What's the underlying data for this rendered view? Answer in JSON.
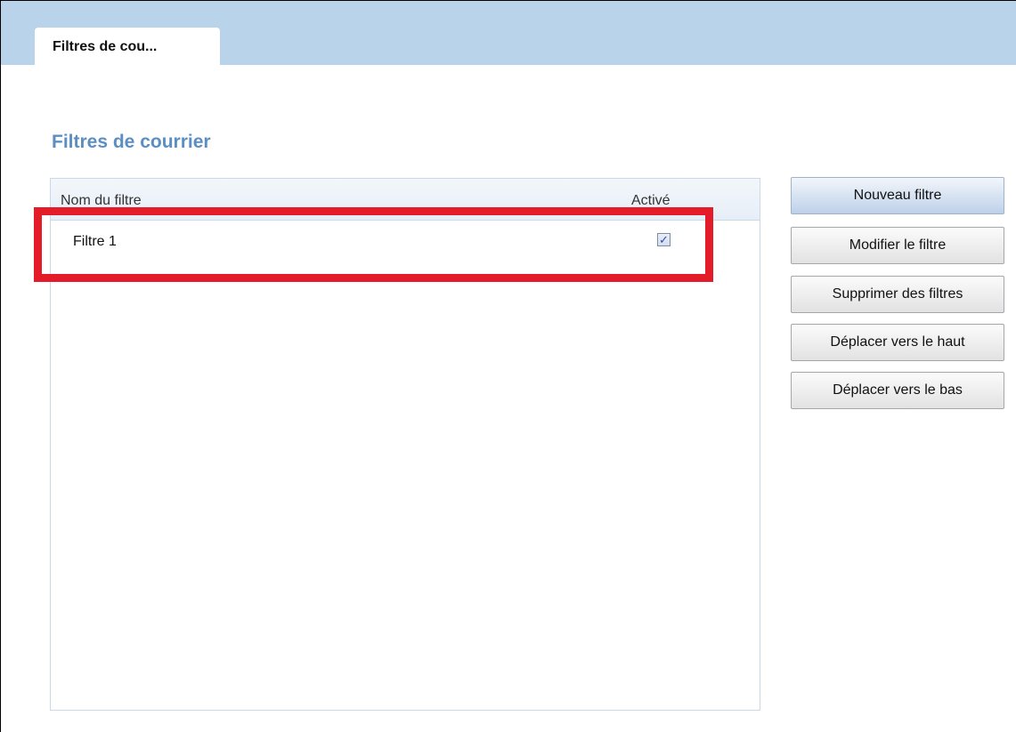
{
  "tab": {
    "label": "Filtres de cou..."
  },
  "section": {
    "title": "Filtres de courrier"
  },
  "table": {
    "headers": {
      "name": "Nom du filtre",
      "active": "Activé"
    },
    "rows": [
      {
        "name": "Filtre 1",
        "active_mark": "✓"
      }
    ]
  },
  "buttons": {
    "new": "Nouveau filtre",
    "edit": "Modifier le filtre",
    "delete": "Supprimer des filtres",
    "move_up": "Déplacer vers le haut",
    "move_down": "Déplacer vers le bas"
  },
  "colors": {
    "tabbar": "#b9d3ea",
    "section_title": "#5b8fc3",
    "highlight": "#e41c2a"
  },
  "icons": {
    "checkbox": "checkbox-checked-icon"
  }
}
